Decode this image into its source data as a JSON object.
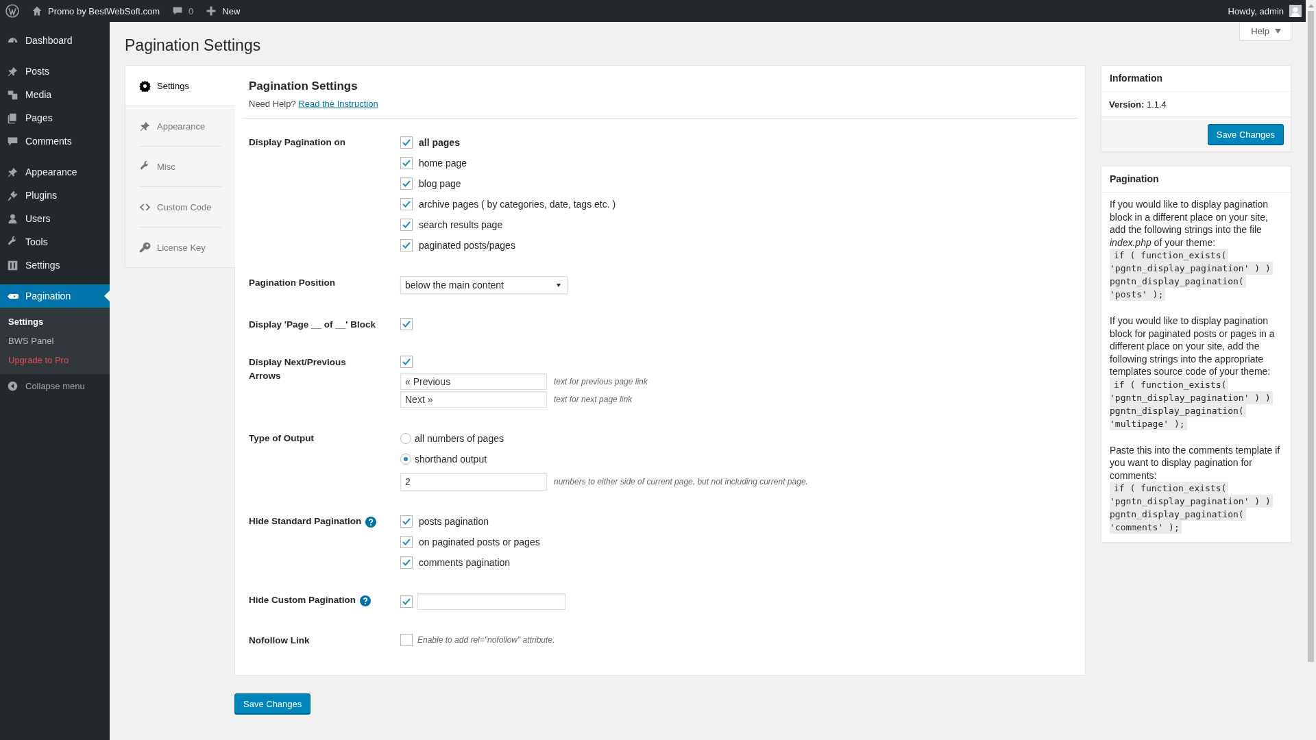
{
  "admin_bar": {
    "site": "Promo by BestWebSoft.com",
    "comments": "0",
    "new": "New",
    "greeting": "Howdy, admin"
  },
  "help_tab": {
    "label": "Help"
  },
  "sidebar": {
    "groups": [
      {
        "items": [
          {
            "label": "Dashboard",
            "selected": false
          }
        ]
      },
      {
        "items": [
          {
            "label": "Posts",
            "selected": false
          },
          {
            "label": "Media",
            "selected": false
          },
          {
            "label": "Pages",
            "selected": false
          },
          {
            "label": "Comments",
            "selected": false
          }
        ]
      },
      {
        "items": [
          {
            "label": "Appearance",
            "selected": false
          },
          {
            "label": "Plugins",
            "selected": false
          },
          {
            "label": "Users",
            "selected": false
          },
          {
            "label": "Tools",
            "selected": false
          },
          {
            "label": "Settings",
            "selected": false
          }
        ]
      },
      {
        "items": [
          {
            "label": "Pagination",
            "selected": true,
            "children": [
              {
                "label": "Settings",
                "selected": true,
                "kind": "link"
              },
              {
                "label": "BWS Panel",
                "selected": false,
                "kind": "link"
              },
              {
                "label": "Upgrade to Pro",
                "selected": false,
                "kind": "upgrade"
              }
            ]
          }
        ]
      }
    ],
    "collapse": "Collapse menu"
  },
  "page_title": "Pagination Settings",
  "tabs": [
    {
      "label": "Settings",
      "selected": true
    },
    {
      "label": "Appearance",
      "selected": false
    },
    {
      "label": "Misc",
      "selected": false
    },
    {
      "label": "Custom Code",
      "selected": false
    },
    {
      "label": "License Key",
      "selected": false
    }
  ],
  "section": {
    "title": "Pagination Settings",
    "help_prefix": "Need Help?",
    "help_link": "Read the Instruction"
  },
  "fields": [
    {
      "kind": "checklist",
      "label": "Display Pagination on",
      "help": false,
      "options": [
        {
          "label": "all pages",
          "checked": true,
          "bold": true
        },
        {
          "label": "home page",
          "checked": true,
          "bold": false
        },
        {
          "label": "blog page",
          "checked": true,
          "bold": false
        },
        {
          "label": "archive pages ( by categories, date, tags etc. )",
          "checked": true,
          "bold": false
        },
        {
          "label": "search results page",
          "checked": true,
          "bold": false
        },
        {
          "label": "paginated posts/pages",
          "checked": true,
          "bold": false
        }
      ]
    },
    {
      "kind": "select",
      "label": "Pagination Position",
      "value": "below the main content"
    },
    {
      "kind": "checkbox",
      "label": "Display 'Page __ of __' Block",
      "checked": true
    },
    {
      "kind": "arrows",
      "label": "Display Next/Previous Arrows",
      "checked": true,
      "inputs": [
        {
          "value": "« Previous",
          "hint": "text for previous page link"
        },
        {
          "value": "Next »",
          "hint": "text for next page link"
        }
      ]
    },
    {
      "kind": "radio",
      "label": "Type of Output",
      "options": [
        {
          "label": "all numbers of pages",
          "selected": false
        },
        {
          "label": "shorthand output",
          "selected": true
        }
      ],
      "number": {
        "value": "2",
        "hint": "numbers to either side of current page, but not including current page."
      }
    },
    {
      "kind": "checklist",
      "label": "Hide Standard Pagination",
      "help": true,
      "options": [
        {
          "label": "posts pagination",
          "checked": true,
          "bold": false
        },
        {
          "label": "on paginated posts or pages",
          "checked": true,
          "bold": false
        },
        {
          "label": "comments pagination",
          "checked": true,
          "bold": false
        }
      ]
    },
    {
      "kind": "checkbox_input",
      "label": "Hide Custom Pagination",
      "help": true,
      "checked": true
    },
    {
      "kind": "checkbox_hint",
      "label": "Nofollow Link",
      "checked": false,
      "hint": "Enable to add rel=\"nofollow\" attribute."
    }
  ],
  "save_button": "Save Changes",
  "info_box": {
    "title": "Information",
    "version_label": "Version:",
    "version": "1.1.4",
    "button": "Save Changes"
  },
  "pagination_box": {
    "title": "Pagination",
    "paragraphs": [
      {
        "text": "If you would like to display pagination block in a different place on your site, add the following strings into the file *index.php* of your theme:",
        "code": [
          "if ( function_exists(",
          "'pgntn_display_pagination' ) )",
          "pgntn_display_pagination(",
          "'posts' );"
        ]
      },
      {
        "text": "If you would like to display pagination block for paginated posts or pages in a different place on your site, add the following strings into the appropriate templates source code of your theme:",
        "code": [
          "if ( function_exists(",
          "'pgntn_display_pagination' ) )",
          "pgntn_display_pagination(",
          "'multipage' );"
        ]
      },
      {
        "text": "Paste this into the comments template if you want to display pagination for comments:",
        "code": [
          "if ( function_exists(",
          "'pgntn_display_pagination' ) )",
          "pgntn_display_pagination(",
          "'comments' );"
        ]
      }
    ]
  }
}
